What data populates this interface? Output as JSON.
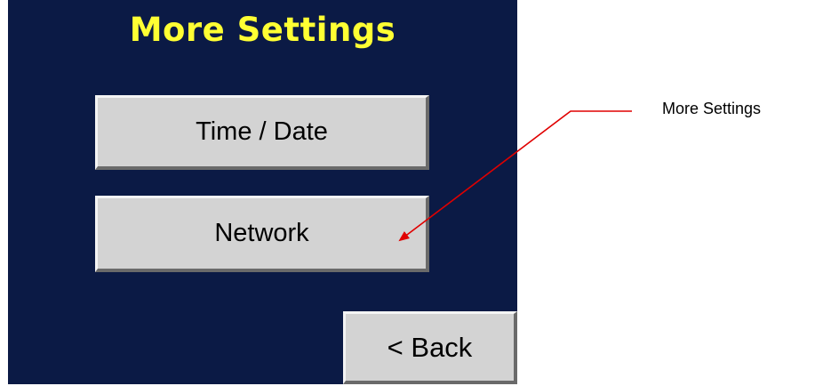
{
  "screen": {
    "title": "More Settings",
    "title_color": "#ffff33",
    "background_color": "#0b1a45"
  },
  "buttons": {
    "time_date": "Time / Date",
    "network": "Network",
    "back": "< Back"
  },
  "annotation": {
    "label": "More Settings",
    "arrow_color": "#e00000"
  }
}
